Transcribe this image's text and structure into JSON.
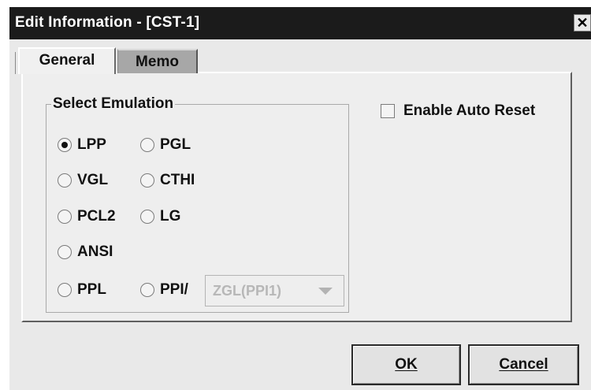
{
  "window": {
    "title": "Edit Information - [CST-1]",
    "close_glyph": "✕"
  },
  "tabs": [
    {
      "label": "General",
      "active": true
    },
    {
      "label": "Memo",
      "active": false
    }
  ],
  "emulation": {
    "title": "Select Emulation",
    "options": [
      {
        "label": "LPP",
        "selected": true
      },
      {
        "label": "PGL",
        "selected": false
      },
      {
        "label": "VGL",
        "selected": false
      },
      {
        "label": "CTHI",
        "selected": false
      },
      {
        "label": "PCL2",
        "selected": false
      },
      {
        "label": "LG",
        "selected": false
      },
      {
        "label": "ANSI",
        "selected": false
      },
      {
        "label": "PPL",
        "selected": false
      },
      {
        "label": "PPI/",
        "selected": false
      }
    ],
    "ppi_combo": {
      "value": "ZGL(PPI1)",
      "enabled": false
    }
  },
  "auto_reset": {
    "label": "Enable Auto Reset",
    "checked": false
  },
  "buttons": {
    "ok": "OK",
    "cancel": "Cancel"
  },
  "colors": {
    "titlebar": "#1b1b1b",
    "dialog_bg": "#e9e9e9",
    "inactive_tab": "#a7a7a7"
  }
}
